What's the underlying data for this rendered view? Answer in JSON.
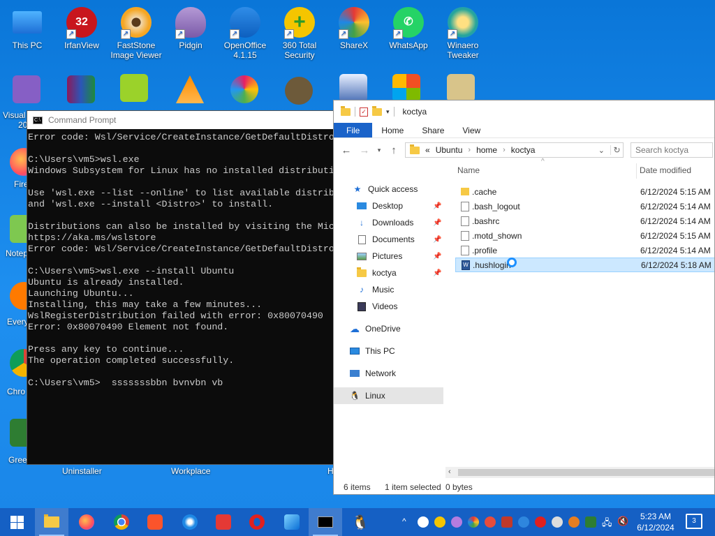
{
  "desktop": {
    "icons": [
      {
        "label": "This PC"
      },
      {
        "label": "IrfanView",
        "badge": "32"
      },
      {
        "label": "FastStone Image Viewer"
      },
      {
        "label": "Pidgin"
      },
      {
        "label": "OpenOffice 4.1.15"
      },
      {
        "label": "360 Total Security"
      },
      {
        "label": "ShareX"
      },
      {
        "label": "WhatsApp"
      },
      {
        "label": "Winaero Tweaker"
      }
    ],
    "partial_labels": [
      "Visual",
      "20",
      "Fire",
      "Notep",
      "Every",
      "Chro",
      "Green",
      "Uninstaller",
      "Workplace",
      "H"
    ]
  },
  "cmd": {
    "title": "Command Prompt",
    "lines": [
      "Error code: Wsl/Service/CreateInstance/GetDefaultDistro",
      "",
      "C:\\Users\\vm5>wsl.exe",
      "Windows Subsystem for Linux has no installed distributi",
      "",
      "Use 'wsl.exe --list --online' to list available distrib",
      "and 'wsl.exe --install <Distro>' to install.",
      "",
      "Distributions can also be installed by visiting the Mic",
      "https://aka.ms/wslstore",
      "Error code: Wsl/Service/CreateInstance/GetDefaultDistro",
      "",
      "C:\\Users\\vm5>wsl.exe --install Ubuntu",
      "Ubuntu is already installed.",
      "Launching Ubuntu...",
      "Installing, this may take a few minutes...",
      "WslRegisterDistribution failed with error: 0x80070490",
      "Error: 0x80070490 Element not found.",
      "",
      "Press any key to continue...",
      "The operation completed successfully.",
      "",
      "C:\\Users\\vm5>  sssssssbbn bvnvbn vb"
    ]
  },
  "explorer": {
    "title": "koctya",
    "ribbon": {
      "file": "File",
      "home": "Home",
      "share": "Share",
      "view": "View"
    },
    "address": {
      "prefix": "«",
      "parts": [
        "Ubuntu",
        "home",
        "koctya"
      ]
    },
    "search_placeholder": "Search koctya",
    "columns": {
      "name": "Name",
      "date": "Date modified"
    },
    "nav": {
      "quick_access": "Quick access",
      "desktop": "Desktop",
      "downloads": "Downloads",
      "documents": "Documents",
      "pictures": "Pictures",
      "koctya": "koctya",
      "music": "Music",
      "videos": "Videos",
      "onedrive": "OneDrive",
      "this_pc": "This PC",
      "network": "Network",
      "linux": "Linux"
    },
    "files": [
      {
        "name": ".cache",
        "date": "6/12/2024 5:15 AM",
        "type": "folder"
      },
      {
        "name": ".bash_logout",
        "date": "6/12/2024 5:14 AM",
        "type": "file"
      },
      {
        "name": ".bashrc",
        "date": "6/12/2024 5:14 AM",
        "type": "file"
      },
      {
        "name": ".motd_shown",
        "date": "6/12/2024 5:15 AM",
        "type": "file"
      },
      {
        "name": ".profile",
        "date": "6/12/2024 5:14 AM",
        "type": "file"
      },
      {
        "name": ".hushlogin",
        "date": "6/12/2024 5:18 AM",
        "type": "doc"
      }
    ],
    "status": {
      "count": "6 items",
      "selected": "1 item selected",
      "size": "0 bytes"
    }
  },
  "taskbar": {
    "clock_time": "5:23 AM",
    "clock_date": "6/12/2024",
    "notifications": "3"
  }
}
